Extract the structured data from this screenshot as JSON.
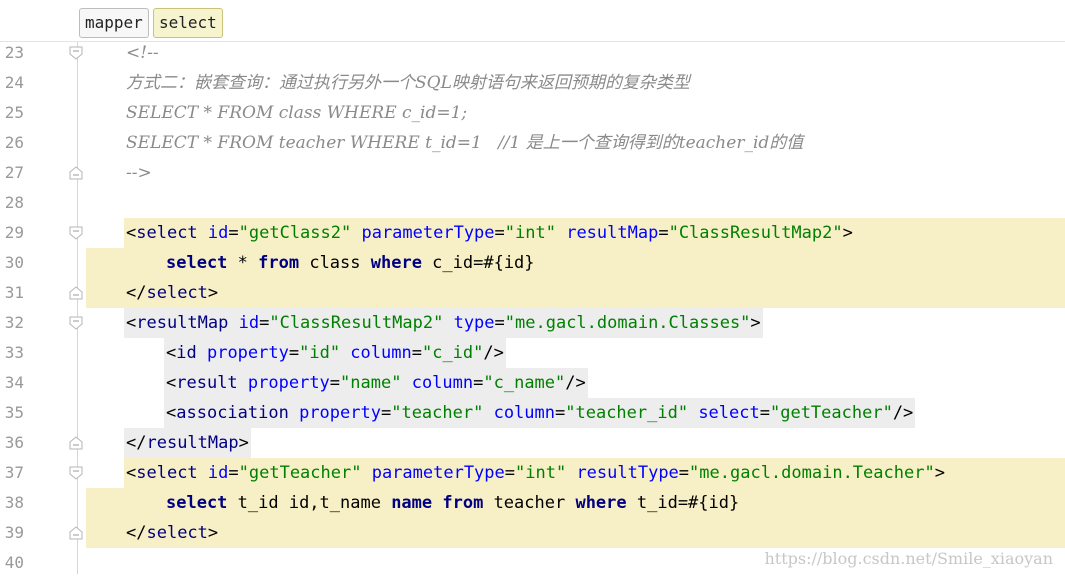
{
  "breadcrumb": {
    "items": [
      "mapper",
      "select"
    ]
  },
  "lines": [
    {
      "n": "23",
      "fold": "open",
      "indent": 1,
      "hl": null,
      "tokens": [
        {
          "t": "cmt",
          "v": "<!--"
        }
      ]
    },
    {
      "n": "24",
      "fold": null,
      "indent": 1,
      "hl": null,
      "tokens": [
        {
          "t": "cmt",
          "v": "方式二：嵌套查询：通过执行另外一个SQL映射语句来返回预期的复杂类型"
        }
      ]
    },
    {
      "n": "25",
      "fold": null,
      "indent": 1,
      "hl": null,
      "tokens": [
        {
          "t": "cmt",
          "v": "SELECT * FROM class WHERE c_id=1;"
        }
      ]
    },
    {
      "n": "26",
      "fold": null,
      "indent": 1,
      "hl": null,
      "tokens": [
        {
          "t": "cmt",
          "v": "SELECT * FROM teacher WHERE t_id=1   //1 是上一个查询得到的teacher_id的值"
        }
      ]
    },
    {
      "n": "27",
      "fold": "close",
      "indent": 1,
      "hl": null,
      "tokens": [
        {
          "t": "cmt",
          "v": "-->"
        }
      ]
    },
    {
      "n": "28",
      "fold": null,
      "indent": 1,
      "hl": null,
      "tokens": []
    },
    {
      "n": "29",
      "fold": "open",
      "indent": 1,
      "hl": "tag",
      "tokens": [
        {
          "t": "br",
          "v": "<"
        },
        {
          "t": "tag",
          "v": "select "
        },
        {
          "t": "attr",
          "v": "id"
        },
        {
          "t": "br",
          "v": "="
        },
        {
          "t": "val",
          "v": "\"getClass2\" "
        },
        {
          "t": "attr",
          "v": "parameterType"
        },
        {
          "t": "br",
          "v": "="
        },
        {
          "t": "val",
          "v": "\"int\" "
        },
        {
          "t": "attr",
          "v": "resultMap"
        },
        {
          "t": "br",
          "v": "="
        },
        {
          "t": "val",
          "v": "\"ClassResultMap2\""
        },
        {
          "t": "br",
          "v": ">"
        }
      ]
    },
    {
      "n": "30",
      "fold": null,
      "indent": 2,
      "hl": "full",
      "tokens": [
        {
          "t": "kw",
          "v": "select "
        },
        {
          "t": "txt",
          "v": "* "
        },
        {
          "t": "kw",
          "v": "from "
        },
        {
          "t": "txt",
          "v": "class "
        },
        {
          "t": "kw",
          "v": "where "
        },
        {
          "t": "txt",
          "v": "c_id=#{id}"
        }
      ]
    },
    {
      "n": "31",
      "fold": "close",
      "indent": 1,
      "hl": "full",
      "tokens": [
        {
          "t": "br",
          "v": "</"
        },
        {
          "t": "tag",
          "v": "select"
        },
        {
          "t": "br",
          "v": ">"
        }
      ]
    },
    {
      "n": "32",
      "fold": "open",
      "indent": 1,
      "hl": "gray",
      "tokens": [
        {
          "t": "br",
          "v": "<"
        },
        {
          "t": "tag",
          "v": "resultMap "
        },
        {
          "t": "attr",
          "v": "id"
        },
        {
          "t": "br",
          "v": "="
        },
        {
          "t": "val",
          "v": "\"ClassResultMap2\" "
        },
        {
          "t": "attr",
          "v": "type"
        },
        {
          "t": "br",
          "v": "="
        },
        {
          "t": "val",
          "v": "\"me.gacl.domain.Classes\""
        },
        {
          "t": "br",
          "v": ">"
        }
      ]
    },
    {
      "n": "33",
      "fold": null,
      "indent": 2,
      "hl": "gray",
      "tokens": [
        {
          "t": "br",
          "v": "<"
        },
        {
          "t": "tag",
          "v": "id "
        },
        {
          "t": "attr",
          "v": "property"
        },
        {
          "t": "br",
          "v": "="
        },
        {
          "t": "val",
          "v": "\"id\" "
        },
        {
          "t": "attr",
          "v": "column"
        },
        {
          "t": "br",
          "v": "="
        },
        {
          "t": "val",
          "v": "\"c_id\""
        },
        {
          "t": "br",
          "v": "/>"
        }
      ]
    },
    {
      "n": "34",
      "fold": null,
      "indent": 2,
      "hl": "gray",
      "tokens": [
        {
          "t": "br",
          "v": "<"
        },
        {
          "t": "tag",
          "v": "result "
        },
        {
          "t": "attr",
          "v": "property"
        },
        {
          "t": "br",
          "v": "="
        },
        {
          "t": "val",
          "v": "\"name\" "
        },
        {
          "t": "attr",
          "v": "column"
        },
        {
          "t": "br",
          "v": "="
        },
        {
          "t": "val",
          "v": "\"c_name\""
        },
        {
          "t": "br",
          "v": "/>"
        }
      ]
    },
    {
      "n": "35",
      "fold": null,
      "indent": 2,
      "hl": "gray",
      "tokens": [
        {
          "t": "br",
          "v": "<"
        },
        {
          "t": "tag",
          "v": "association "
        },
        {
          "t": "attr",
          "v": "property"
        },
        {
          "t": "br",
          "v": "="
        },
        {
          "t": "val",
          "v": "\"teacher\" "
        },
        {
          "t": "attr",
          "v": "column"
        },
        {
          "t": "br",
          "v": "="
        },
        {
          "t": "val",
          "v": "\"teacher_id\" "
        },
        {
          "t": "attr",
          "v": "select"
        },
        {
          "t": "br",
          "v": "="
        },
        {
          "t": "val",
          "v": "\"getTeacher\""
        },
        {
          "t": "br",
          "v": "/>"
        }
      ]
    },
    {
      "n": "36",
      "fold": "close",
      "indent": 1,
      "hl": "gray",
      "tokens": [
        {
          "t": "br",
          "v": "</"
        },
        {
          "t": "tag",
          "v": "resultMap"
        },
        {
          "t": "br",
          "v": ">"
        }
      ]
    },
    {
      "n": "37",
      "fold": "open",
      "indent": 1,
      "hl": "tag",
      "tokens": [
        {
          "t": "br",
          "v": "<"
        },
        {
          "t": "tag",
          "v": "select "
        },
        {
          "t": "attr",
          "v": "id"
        },
        {
          "t": "br",
          "v": "="
        },
        {
          "t": "val",
          "v": "\"getTeacher\" "
        },
        {
          "t": "attr",
          "v": "parameterType"
        },
        {
          "t": "br",
          "v": "="
        },
        {
          "t": "val",
          "v": "\"int\" "
        },
        {
          "t": "attr",
          "v": "resultType"
        },
        {
          "t": "br",
          "v": "="
        },
        {
          "t": "val",
          "v": "\"me.gacl.domain.Teacher\""
        },
        {
          "t": "br",
          "v": ">"
        }
      ]
    },
    {
      "n": "38",
      "fold": null,
      "indent": 2,
      "hl": "full",
      "tokens": [
        {
          "t": "kw",
          "v": "select "
        },
        {
          "t": "txt",
          "v": "t_id id,t_name "
        },
        {
          "t": "kw",
          "v": "name "
        },
        {
          "t": "kw",
          "v": "from "
        },
        {
          "t": "txt",
          "v": "teacher "
        },
        {
          "t": "kw",
          "v": "where "
        },
        {
          "t": "txt",
          "v": "t_id=#{id}"
        }
      ]
    },
    {
      "n": "39",
      "fold": "close",
      "indent": 1,
      "hl": "full",
      "tokens": [
        {
          "t": "br",
          "v": "</"
        },
        {
          "t": "tag",
          "v": "select"
        },
        {
          "t": "br",
          "v": ">"
        }
      ]
    },
    {
      "n": "40",
      "fold": null,
      "indent": 1,
      "hl": null,
      "tokens": []
    }
  ],
  "watermark": "https://blog.csdn.net/Smile_xiaoyan",
  "colors": {
    "highlight": "#f7efc6",
    "gray": "#ededed",
    "tag": "#000080",
    "attr": "#0000ff",
    "value": "#008000",
    "comment": "#8a8a8a"
  }
}
